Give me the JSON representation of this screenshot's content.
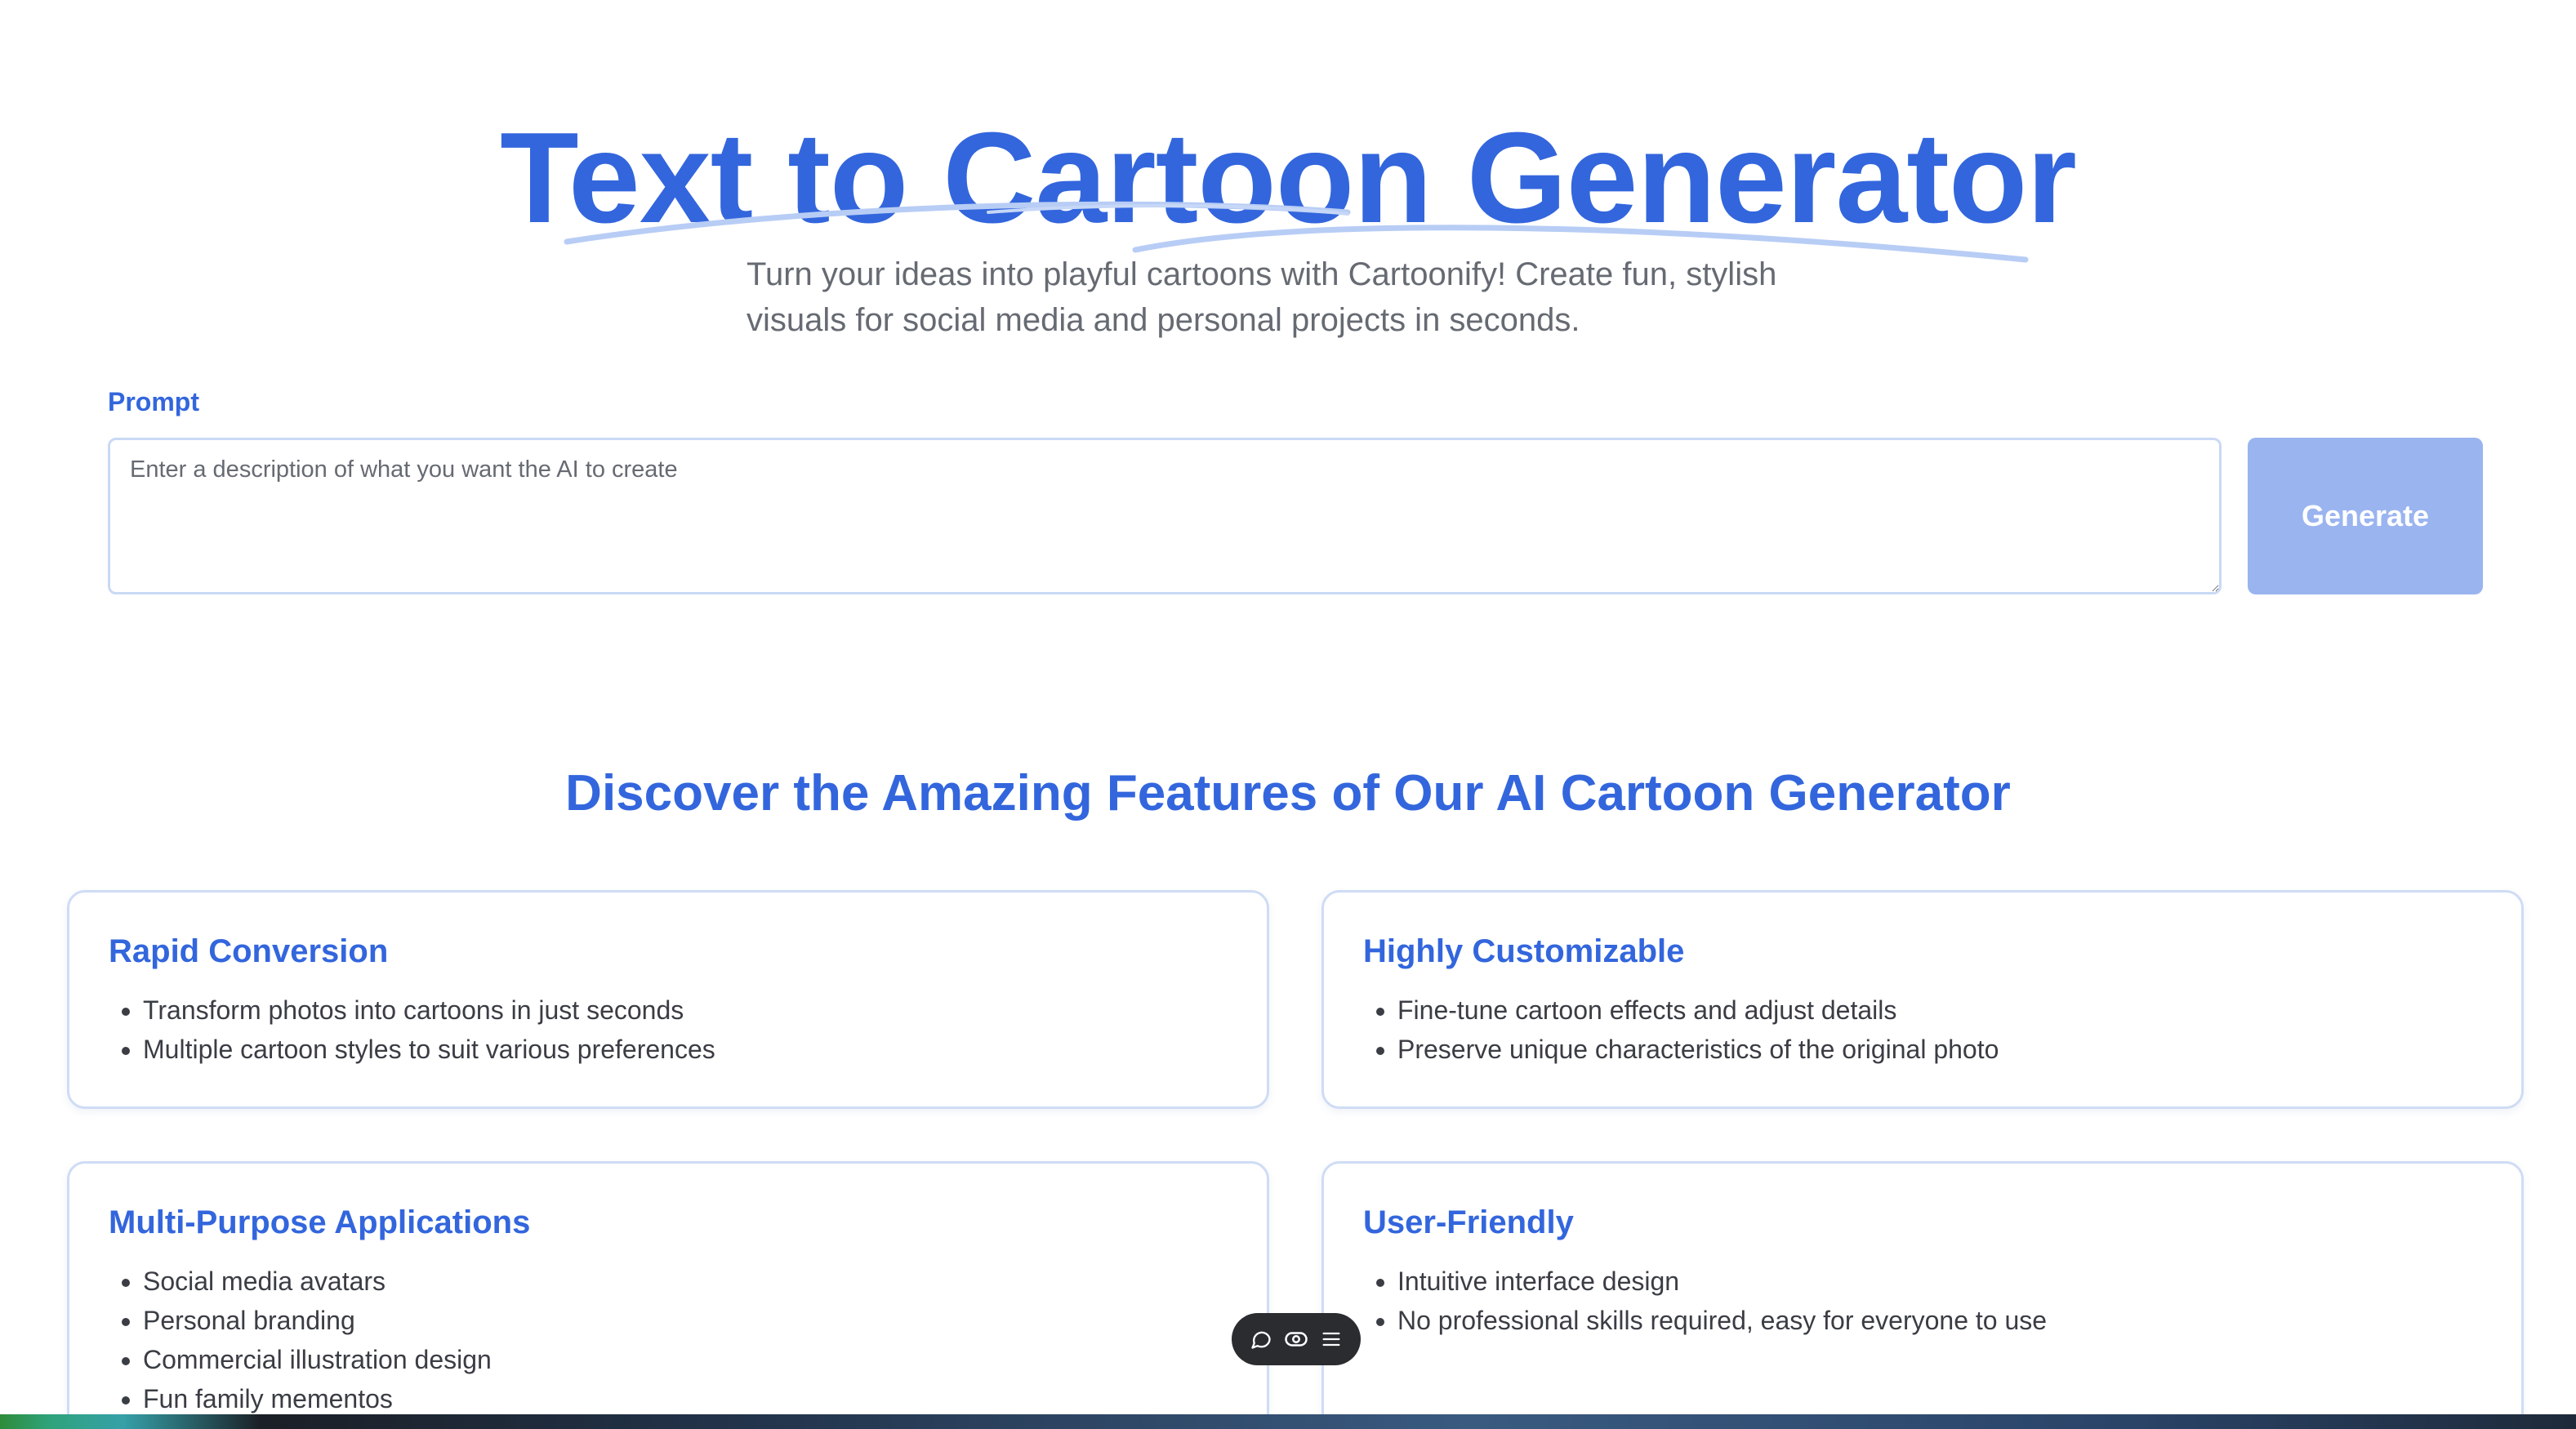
{
  "hero": {
    "title": "Text to Cartoon Generator",
    "subtitle": "Turn your ideas into playful cartoons with Cartoonify! Create fun, stylish visuals for social media and personal projects in seconds."
  },
  "prompt": {
    "label": "Prompt",
    "placeholder": "Enter a description of what you want the AI to create",
    "value": ""
  },
  "generate_button": {
    "label": "Generate"
  },
  "features": {
    "heading": "Discover the Amazing Features of Our AI Cartoon Generator",
    "cards": [
      {
        "title": "Rapid Conversion",
        "items": [
          "Transform photos into cartoons in just seconds",
          "Multiple cartoon styles to suit various preferences"
        ]
      },
      {
        "title": "Highly Customizable",
        "items": [
          "Fine-tune cartoon effects and adjust details",
          "Preserve unique characteristics of the original photo"
        ]
      },
      {
        "title": "Multi-Purpose Applications",
        "items": [
          "Social media avatars",
          "Personal branding",
          "Commercial illustration design",
          "Fun family mementos"
        ]
      },
      {
        "title": "User-Friendly",
        "items": [
          "Intuitive interface design",
          "No professional skills required, easy for everyone to use"
        ]
      }
    ]
  },
  "floating_toolbar": {
    "icons": [
      "comment-icon",
      "eye-icon",
      "menu-icon"
    ]
  },
  "colors": {
    "accent": "#3366dd",
    "button_disabled": "#9ab4f0",
    "border": "#c9d9f5",
    "body_text": "#3a3d44",
    "muted_text": "#666a72"
  }
}
